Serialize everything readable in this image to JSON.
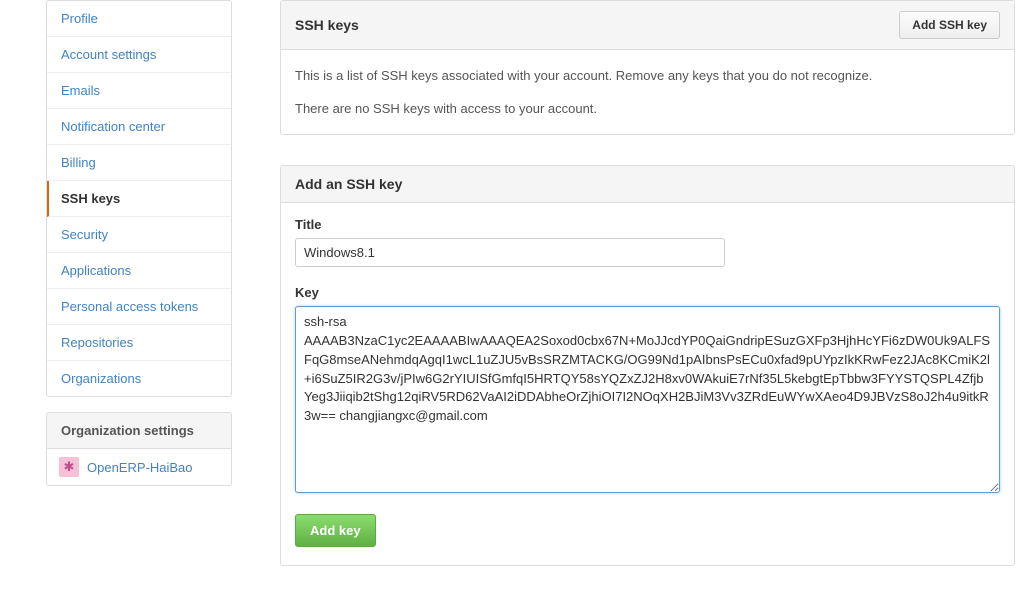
{
  "sidebar": {
    "items": [
      {
        "label": "Profile",
        "active": false
      },
      {
        "label": "Account settings",
        "active": false
      },
      {
        "label": "Emails",
        "active": false
      },
      {
        "label": "Notification center",
        "active": false
      },
      {
        "label": "Billing",
        "active": false
      },
      {
        "label": "SSH keys",
        "active": true
      },
      {
        "label": "Security",
        "active": false
      },
      {
        "label": "Applications",
        "active": false
      },
      {
        "label": "Personal access tokens",
        "active": false
      },
      {
        "label": "Repositories",
        "active": false
      },
      {
        "label": "Organizations",
        "active": false
      }
    ],
    "org_header": "Organization settings",
    "orgs": [
      {
        "label": "OpenERP-HaiBao"
      }
    ]
  },
  "ssh_panel": {
    "title": "SSH keys",
    "add_button": "Add SSH key",
    "desc1": "This is a list of SSH keys associated with your account. Remove any keys that you do not recognize.",
    "desc2": "There are no SSH keys with access to your account."
  },
  "add_panel": {
    "title": "Add an SSH key",
    "title_label": "Title",
    "title_value": "Windows8.1",
    "key_label": "Key",
    "key_value": "ssh-rsa AAAAB3NzaC1yc2EAAAABIwAAAQEA2Soxod0cbx67N+MoJJcdYP0QaiGndripESuzGXFp3HjhHcYFi6zDW0Uk9ALFSFqG8mseANehmdqAgqI1wcL1uZJU5vBsSRZMTACKG/OG99Nd1pAIbnsPsECu0xfad9pUYpzIkKRwFez2JAc8KCmiK2l+i6SuZ5IR2G3v/jPIw6G2rYIUISfGmfqI5HRTQY58sYQZxZJ2H8xv0WAkuiE7rNf35L5kebgtEpTbbw3FYYSTQSPL4ZfjbYeg3Jiiqib2tShg12qiRV5RD62VaAI2iDDAbheOrZjhiOI7I2NOqXH2BJiM3Vv3ZRdEuWYwXAeo4D9JBVzS8oJ2h4u9itkR3w== changjiangxc@gmail.com",
    "submit_label": "Add key"
  }
}
